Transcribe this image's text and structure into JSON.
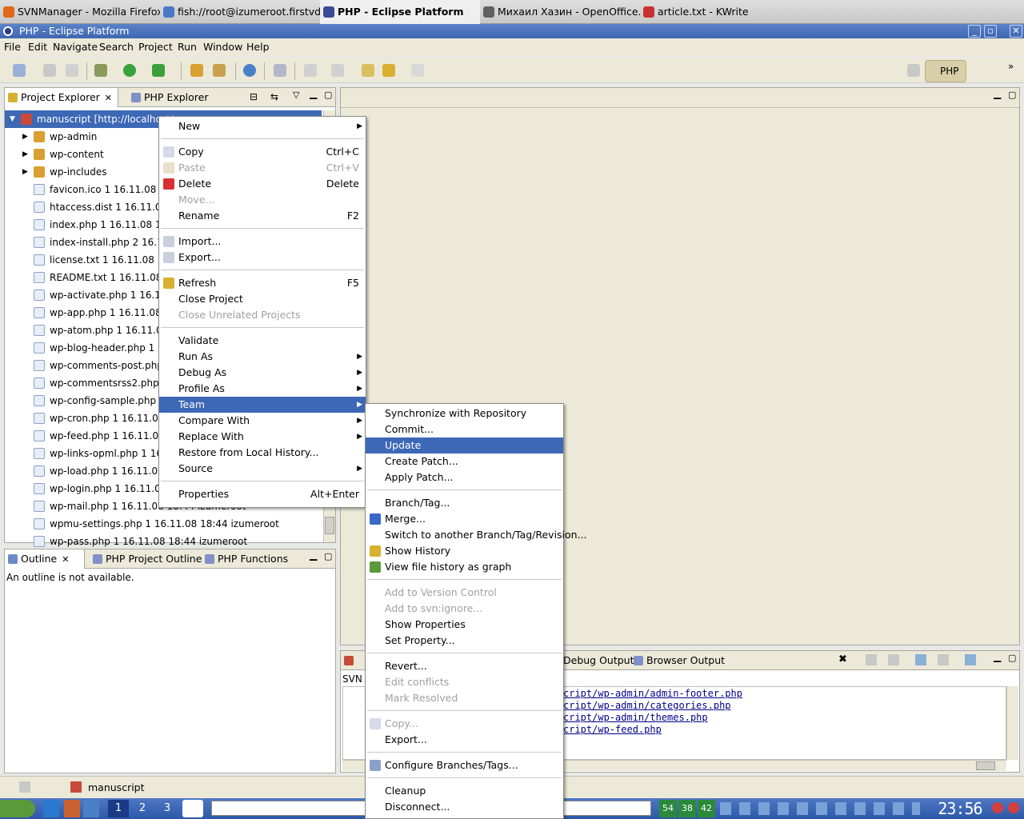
{
  "taskbar": {
    "tasks": [
      {
        "label": "SVNManager - Mozilla Firefox",
        "color": "#e06818"
      },
      {
        "label": "fish://root@izumeroot.firstvds.ru",
        "color": "#4a78c8"
      },
      {
        "label": "PHP - Eclipse Platform",
        "color": "#3a4a98"
      },
      {
        "label": "Михаил Хазин - OpenOffice.org",
        "color": "#606060"
      },
      {
        "label": "article.txt - KWrite",
        "color": "#c83030"
      }
    ]
  },
  "window": {
    "title": "PHP - Eclipse Platform"
  },
  "menubar": [
    "File",
    "Edit",
    "Navigate",
    "Search",
    "Project",
    "Run",
    "Window",
    "Help"
  ],
  "perspective": {
    "label": "PHP"
  },
  "explorer": {
    "tabs": [
      "Project Explorer",
      "PHP Explorer"
    ],
    "root": "manuscript [http://localhost/",
    "items": [
      {
        "label": "wp-admin",
        "folder": true
      },
      {
        "label": "wp-content",
        "folder": true
      },
      {
        "label": "wp-includes",
        "folder": true
      },
      {
        "label": "favicon.ico 1  16.11.08 18"
      },
      {
        "label": "htaccess.dist 1  16.11.08"
      },
      {
        "label": "index.php 1  16.11.08 18:"
      },
      {
        "label": "index-install.php 2  16.11"
      },
      {
        "label": "license.txt 1  16.11.08 18"
      },
      {
        "label": "README.txt 1  16.11.08 1"
      },
      {
        "label": "wp-activate.php 1  16.11.0"
      },
      {
        "label": "wp-app.php 1  16.11.08 1"
      },
      {
        "label": "wp-atom.php 1  16.11.08"
      },
      {
        "label": "wp-blog-header.php 1  16"
      },
      {
        "label": "wp-comments-post.php 1"
      },
      {
        "label": "wp-commentsrss2.php 1"
      },
      {
        "label": "wp-config-sample.php 1"
      },
      {
        "label": "wp-cron.php 1  16.11.08"
      },
      {
        "label": "wp-feed.php 1  16.11.08"
      },
      {
        "label": "wp-links-opml.php 1  16."
      },
      {
        "label": "wp-load.php 1  16.11.08"
      },
      {
        "label": "wp-login.php 1  16.11.08"
      },
      {
        "label": "wp-mail.php 1  16.11.08 18:44  izumeroot"
      },
      {
        "label": "wpmu-settings.php 1  16.11.08 18:44  izumeroot"
      },
      {
        "label": "wp-pass.php 1  16.11.08 18:44  izumeroot"
      }
    ]
  },
  "outline": {
    "tabs": [
      "Outline",
      "PHP Project Outline",
      "PHP Functions"
    ],
    "message": "An outline is not available."
  },
  "context_menu": {
    "items": [
      {
        "label": "New",
        "sub": true
      },
      {
        "sep": true
      },
      {
        "label": "Copy",
        "accel": "Ctrl+C",
        "icon": "copy-icon"
      },
      {
        "label": "Paste",
        "accel": "Ctrl+V",
        "disabled": true,
        "icon": "paste-icon"
      },
      {
        "label": "Delete",
        "accel": "Delete",
        "icon": "delete-icon"
      },
      {
        "label": "Move...",
        "disabled": true
      },
      {
        "label": "Rename",
        "accel": "F2"
      },
      {
        "sep": true
      },
      {
        "label": "Import...",
        "icon": "import-icon"
      },
      {
        "label": "Export...",
        "icon": "export-icon"
      },
      {
        "sep": true
      },
      {
        "label": "Refresh",
        "accel": "F5",
        "icon": "refresh-icon"
      },
      {
        "label": "Close Project"
      },
      {
        "label": "Close Unrelated Projects",
        "disabled": true
      },
      {
        "sep": true
      },
      {
        "label": "Validate"
      },
      {
        "label": "Run As",
        "sub": true
      },
      {
        "label": "Debug As",
        "sub": true
      },
      {
        "label": "Profile As",
        "sub": true
      },
      {
        "label": "Team",
        "sub": true,
        "highlight": true
      },
      {
        "label": "Compare With",
        "sub": true
      },
      {
        "label": "Replace With",
        "sub": true
      },
      {
        "label": "Restore from Local History..."
      },
      {
        "label": "Source",
        "sub": true
      },
      {
        "sep": true
      },
      {
        "label": "Properties",
        "accel": "Alt+Enter"
      }
    ]
  },
  "team_menu": {
    "items": [
      {
        "label": "Synchronize with Repository"
      },
      {
        "label": "Commit..."
      },
      {
        "label": "Update",
        "highlight": true
      },
      {
        "label": "Create Patch..."
      },
      {
        "label": "Apply Patch..."
      },
      {
        "sep": true
      },
      {
        "label": "Branch/Tag..."
      },
      {
        "label": "Merge...",
        "icon": "merge-icon"
      },
      {
        "label": "Switch to another Branch/Tag/Revision..."
      },
      {
        "label": "Show History",
        "icon": "history-icon"
      },
      {
        "label": "View file history as graph",
        "icon": "graph-icon"
      },
      {
        "sep": true
      },
      {
        "label": "Add to Version Control",
        "disabled": true
      },
      {
        "label": "Add to svn:ignore...",
        "disabled": true
      },
      {
        "label": "Show Properties"
      },
      {
        "label": "Set Property..."
      },
      {
        "sep": true
      },
      {
        "label": "Revert..."
      },
      {
        "label": "Edit conflicts",
        "disabled": true
      },
      {
        "label": "Mark Resolved",
        "disabled": true
      },
      {
        "sep": true
      },
      {
        "label": "Copy...",
        "disabled": true,
        "icon": "copy-icon"
      },
      {
        "label": "Export..."
      },
      {
        "sep": true
      },
      {
        "label": "Configure Branches/Tags...",
        "icon": "config-icon"
      },
      {
        "sep": true
      },
      {
        "label": "Cleanup"
      },
      {
        "label": "Disconnect..."
      }
    ]
  },
  "console": {
    "tabs": [
      "Debug Output",
      "Browser Output"
    ],
    "tab_label": "SVN",
    "links": [
      "cript/wp-admin/admin-footer.php",
      "cript/wp-admin/categories.php",
      "cript/wp-admin/themes.php",
      "cript/wp-feed.php"
    ]
  },
  "statusbar": {
    "project": "manuscript"
  },
  "kpanel": {
    "desktops": [
      "1",
      "2",
      "3"
    ],
    "clock": "23:56",
    "meters": [
      "54",
      "38",
      "42"
    ]
  }
}
